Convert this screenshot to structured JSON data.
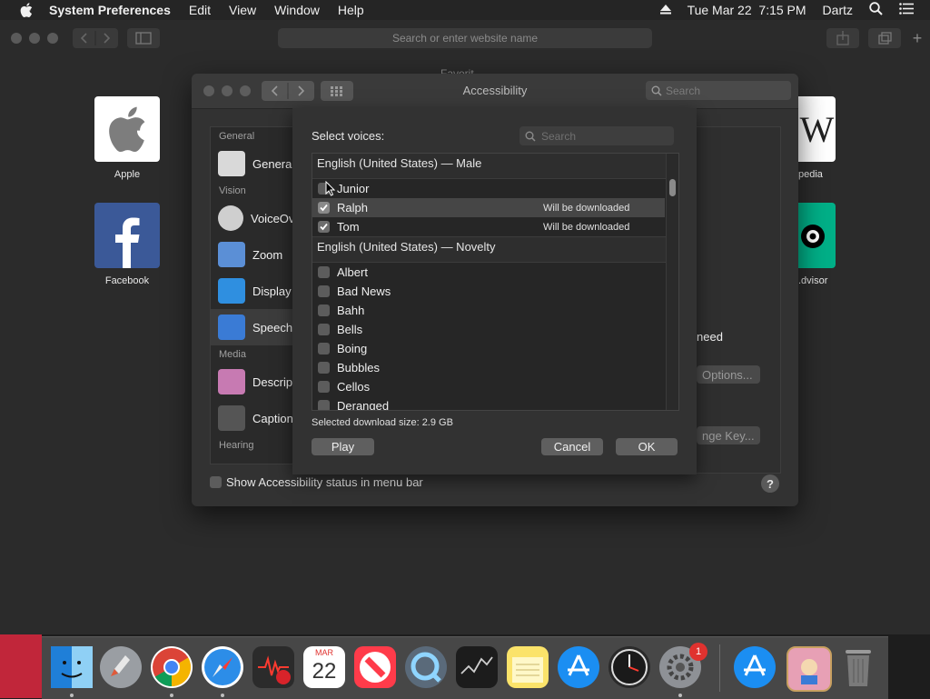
{
  "menubar": {
    "app_name": "System Preferences",
    "items": [
      "Edit",
      "View",
      "Window",
      "Help"
    ],
    "datetime": "Tue Mar 22  7:15 PM",
    "user": "Dartz"
  },
  "safari": {
    "address_placeholder": "Search or enter website name",
    "page_title_partial": "Favorit"
  },
  "favorites": [
    {
      "label": "Apple",
      "icon": "apple-logo-icon"
    },
    {
      "label": "Facebook",
      "icon": "facebook-logo-icon"
    }
  ],
  "favorites_partial": [
    {
      "label": "pedia",
      "icon": "wikipedia-logo-icon"
    },
    {
      "label": ".dvisor",
      "icon": "tripadvisor-logo-icon"
    }
  ],
  "accessibility_window": {
    "title": "Accessibility",
    "search_placeholder": "Search",
    "sidebar": [
      {
        "group": "General",
        "items": [
          {
            "label": "General",
            "icon": "general-icon"
          }
        ]
      },
      {
        "group": "Vision",
        "items": [
          {
            "label": "VoiceOver",
            "icon": "voiceover-icon"
          },
          {
            "label": "Zoom",
            "icon": "zoom-icon"
          },
          {
            "label": "Display",
            "icon": "display-icon"
          },
          {
            "label": "Speech",
            "icon": "speech-icon"
          }
        ]
      },
      {
        "group": "Media",
        "items": [
          {
            "label": "Descriptions",
            "icon": "descriptions-icon"
          },
          {
            "label": "Captions",
            "icon": "captions-icon"
          }
        ]
      },
      {
        "group": "Hearing",
        "items": []
      }
    ],
    "right_text_partial": "need",
    "options_button_partial": "Options...",
    "change_key_partial": "nge Key...",
    "status_checkbox_label": "Show Accessibility status in menu bar",
    "help": "?"
  },
  "voices_sheet": {
    "label": "Select voices:",
    "search_placeholder": "Search",
    "groups": [
      {
        "header": "English (United States) — Male",
        "voices": [
          {
            "name": "Junior",
            "checked": false,
            "note": ""
          },
          {
            "name": "Ralph",
            "checked": true,
            "note": "Will be downloaded"
          },
          {
            "name": "Tom",
            "checked": true,
            "note": "Will be downloaded"
          }
        ]
      },
      {
        "header": "English (United States) — Novelty",
        "voices": [
          {
            "name": "Albert",
            "checked": false,
            "note": ""
          },
          {
            "name": "Bad News",
            "checked": false,
            "note": ""
          },
          {
            "name": "Bahh",
            "checked": false,
            "note": ""
          },
          {
            "name": "Bells",
            "checked": false,
            "note": ""
          },
          {
            "name": "Boing",
            "checked": false,
            "note": ""
          },
          {
            "name": "Bubbles",
            "checked": false,
            "note": ""
          },
          {
            "name": "Cellos",
            "checked": false,
            "note": ""
          },
          {
            "name": "Deranged",
            "checked": false,
            "note": ""
          }
        ]
      }
    ],
    "download_size": "Selected download size: 2.9 GB",
    "play_button": "Play",
    "cancel_button": "Cancel",
    "ok_button": "OK"
  },
  "dock": {
    "calendar_month": "MAR",
    "calendar_day": "22",
    "system_prefs_badge": "1",
    "apps": [
      "finder",
      "launchpad",
      "chrome",
      "safari",
      "voice-memos",
      "calendar",
      "news",
      "quicktime",
      "stocks",
      "notes",
      "app-store",
      "clock",
      "system-preferences",
      "app-store-downloads",
      "photo-booth",
      "trash"
    ]
  }
}
